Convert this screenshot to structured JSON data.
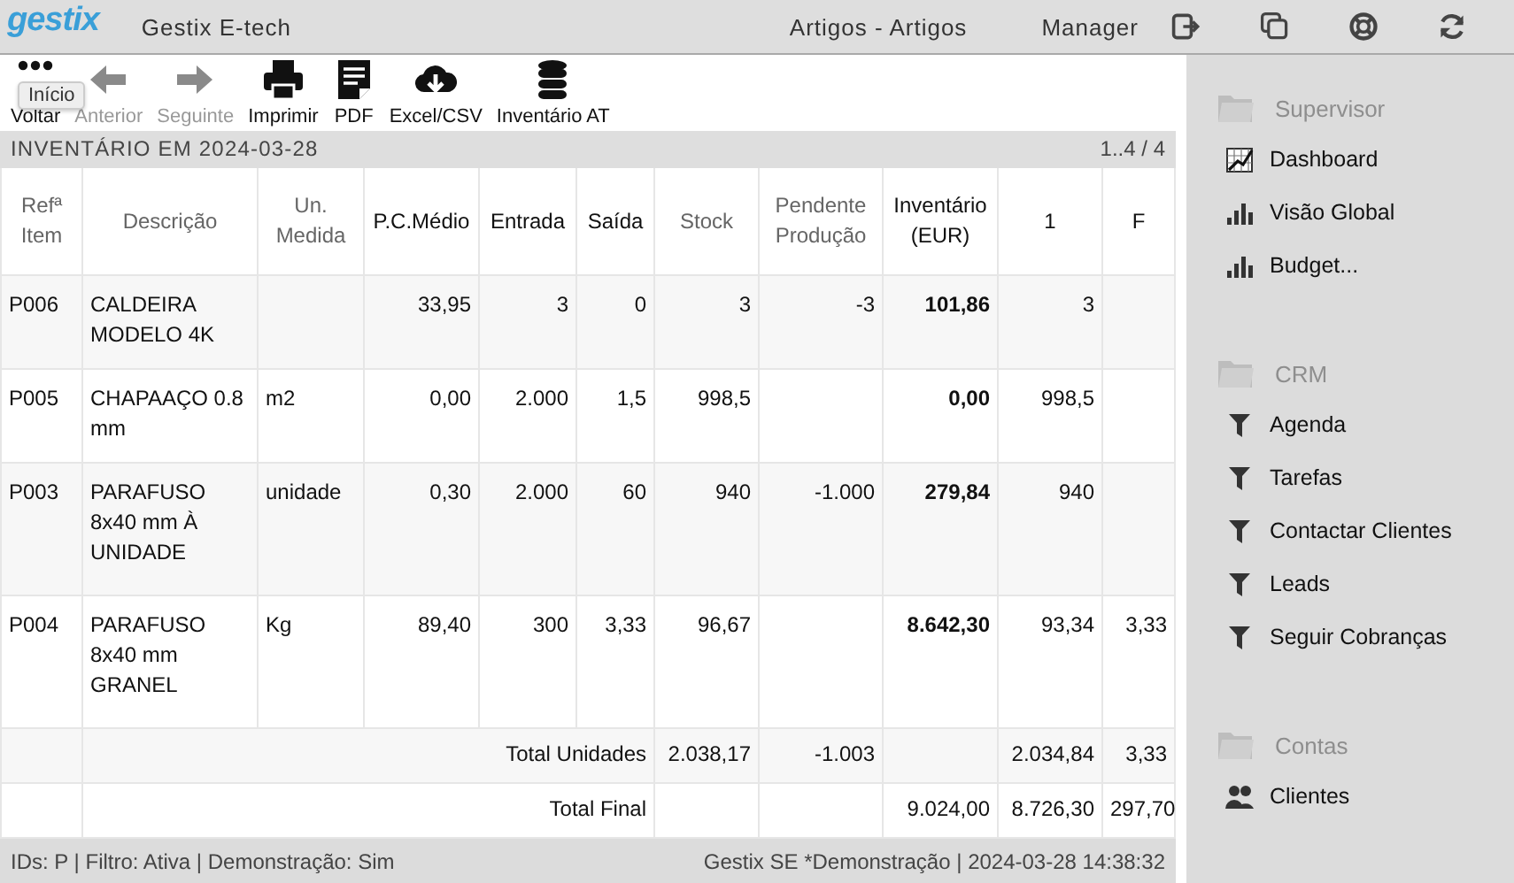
{
  "topbar": {
    "logo": "gestix",
    "company": "Gestix E-tech",
    "module": "Artigos - Artigos",
    "user": "Manager",
    "icons": [
      {
        "kind": "exit"
      },
      {
        "kind": "copy"
      },
      {
        "kind": "help"
      },
      {
        "kind": "refresh"
      }
    ]
  },
  "toolbar": {
    "buttons": [
      {
        "kind": "dots",
        "label": "Voltar",
        "disabled": false
      },
      {
        "kind": "back",
        "label": "Anterior",
        "disabled": true
      },
      {
        "kind": "forward",
        "label": "Seguinte",
        "disabled": true
      },
      {
        "kind": "print",
        "label": "Imprimir",
        "disabled": false
      },
      {
        "kind": "pdf",
        "label": "PDF",
        "disabled": false
      },
      {
        "kind": "download",
        "label": "Excel/CSV",
        "disabled": false
      },
      {
        "kind": "database",
        "label": "Inventário AT",
        "disabled": false
      }
    ],
    "tooltip": "Início"
  },
  "report": {
    "title": "INVENTÁRIO EM 2024-03-28",
    "pagination": "1..4 / 4"
  },
  "table": {
    "columns": [
      {
        "label": "Refª Item",
        "emphasized": false
      },
      {
        "label": "Descrição",
        "emphasized": false
      },
      {
        "label": "Un. Medida",
        "emphasized": false
      },
      {
        "label": "P.C.Médio",
        "emphasized": true
      },
      {
        "label": "Entrada",
        "emphasized": true
      },
      {
        "label": "Saída",
        "emphasized": true
      },
      {
        "label": "Stock",
        "emphasized": false
      },
      {
        "label": "Pendente Produção",
        "emphasized": false
      },
      {
        "label": "Inventário (EUR)",
        "emphasized": true
      },
      {
        "label": "1",
        "emphasized": true
      },
      {
        "label": "F",
        "emphasized": true
      }
    ],
    "rows": [
      {
        "cells": [
          "P006",
          "CALDEIRA MODELO 4K",
          null,
          "33,95",
          "3",
          "0",
          "3",
          "-3",
          "101,86",
          "3",
          null
        ]
      },
      {
        "cells": [
          "P005",
          "CHAPAAÇO 0.8 mm",
          "m2",
          "0,00",
          "2.000",
          "1,5",
          "998,5",
          null,
          "0,00",
          "998,5",
          null
        ]
      },
      {
        "cells": [
          "P003",
          "PARAFUSO 8x40 mm À UNIDADE",
          "unidade",
          "0,30",
          "2.000",
          "60",
          "940",
          "-1.000",
          "279,84",
          "940",
          null
        ]
      },
      {
        "cells": [
          "P004",
          "PARAFUSO 8x40 mm GRANEL",
          "Kg",
          "89,40",
          "300",
          "3,33",
          "96,67",
          null,
          "8.642,30",
          "93,34",
          "3,33"
        ]
      }
    ],
    "totals": [
      {
        "label": "Total Unidades",
        "cells": [
          "2.038,17",
          "-1.003",
          null,
          "2.034,84",
          "3,33"
        ]
      },
      {
        "label": "Total Final",
        "cells": [
          null,
          null,
          "9.024,00",
          "8.726,30",
          "297,70"
        ]
      }
    ]
  },
  "status_bar": {
    "left": "IDs: P | Filtro: Ativa | Demonstração: Sim",
    "right": "Gestix SE *Demonstração | 2024-03-28 14:38:32"
  },
  "sidebar": {
    "sections": [
      {
        "title": "Supervisor",
        "items": [
          {
            "kind": "dashboard",
            "label": "Dashboard"
          },
          {
            "kind": "bars",
            "label": "Visão Global"
          },
          {
            "kind": "bars",
            "label": "Budget..."
          }
        ]
      },
      {
        "title": "CRM",
        "items": [
          {
            "kind": "funnel",
            "label": "Agenda"
          },
          {
            "kind": "funnel",
            "label": "Tarefas"
          },
          {
            "kind": "funnel",
            "label": "Contactar Clientes"
          },
          {
            "kind": "funnel",
            "label": "Leads"
          },
          {
            "kind": "funnel",
            "label": "Seguir Cobranças"
          }
        ]
      },
      {
        "title": "Contas",
        "items": [
          {
            "kind": "people",
            "label": "Clientes"
          }
        ]
      }
    ]
  }
}
